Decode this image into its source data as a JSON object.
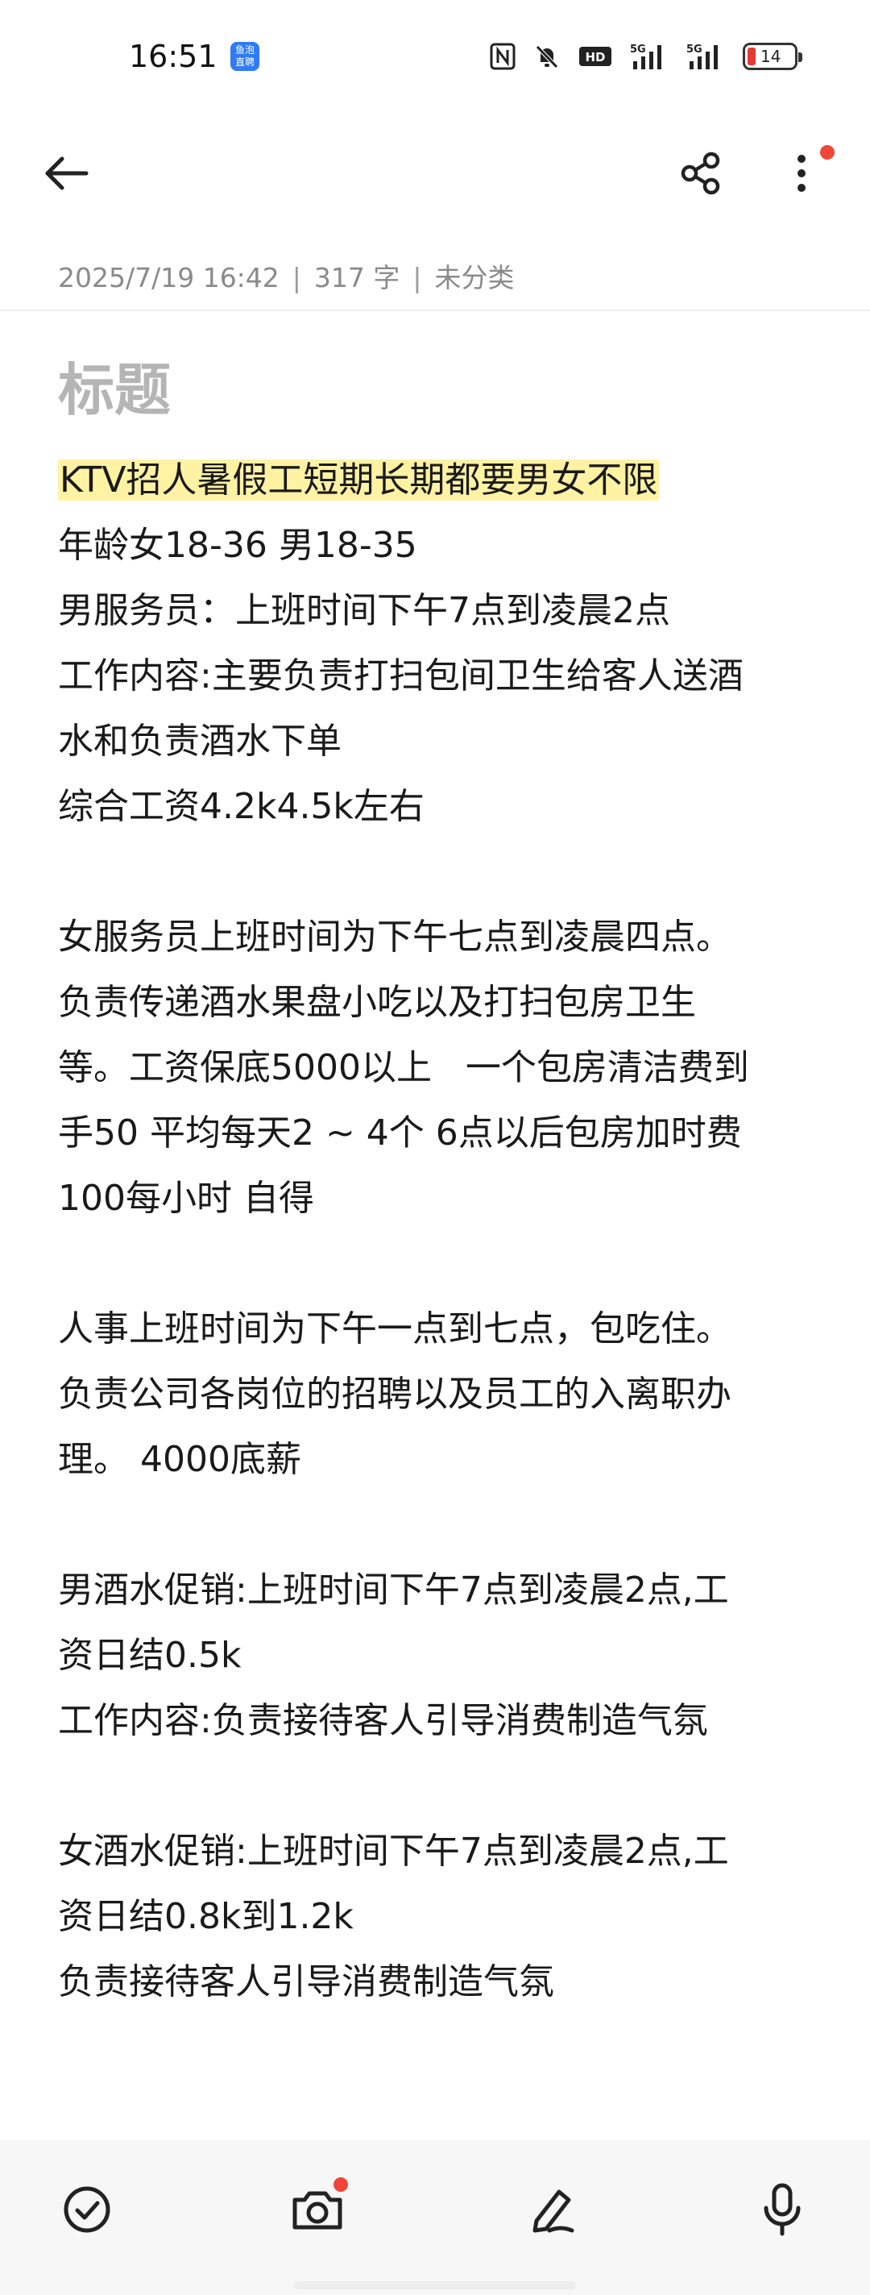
{
  "status_bar": {
    "time": "16:51",
    "notif_text": "鱼泡\n直聘",
    "signal_labels": [
      "HD",
      "5G",
      "5G"
    ],
    "battery": "14"
  },
  "top_bar": {
    "back_icon": "arrow-left-icon",
    "share_icon": "share-icon",
    "more_icon": "more-vertical-icon"
  },
  "meta": {
    "date": "2025/7/19 16:42",
    "count": "317 字",
    "category": "未分类",
    "separator": "|"
  },
  "note": {
    "title": "标题",
    "highlighted_line": "KTV招人暑假工短期长期都要男女不限",
    "lines": [
      "年龄女18-36 男18-35",
      "男服务员：上班时间下午7点到凌晨2点",
      "工作内容:主要负责打扫包间卫生给客人送酒",
      "水和负责酒水下单",
      "综合工资4.2k4.5k左右",
      "",
      "女服务员上班时间为下午七点到凌晨四点。",
      "负责传递酒水果盘小吃以及打扫包房卫生",
      "等。工资保底5000以上   一个包房清洁费到",
      "手50 平均每天2 ~ 4个 6点以后包房加时费",
      "100每小时 自得",
      "",
      "人事上班时间为下午一点到七点，包吃住。",
      "负责公司各岗位的招聘以及员工的入离职办",
      "理。 4000底薪",
      "",
      "男酒水促销:上班时间下午7点到凌晨2点,工",
      "资日结0.5k",
      "工作内容:负责接待客人引导消费制造气氛",
      "",
      "女酒水促销:上班时间下午7点到凌晨2点,工",
      "资日结0.8k到1.2k",
      "负责接待客人引导消费制造气氛"
    ]
  },
  "toolbar": {
    "items": [
      "checklist-icon",
      "camera-icon",
      "pen-icon",
      "microphone-icon"
    ]
  },
  "colors": {
    "highlight": "#fff2a3",
    "badge_red": "#f0463a",
    "meta_gray": "#8a8a8a",
    "title_gray": "#b5b5b5"
  }
}
